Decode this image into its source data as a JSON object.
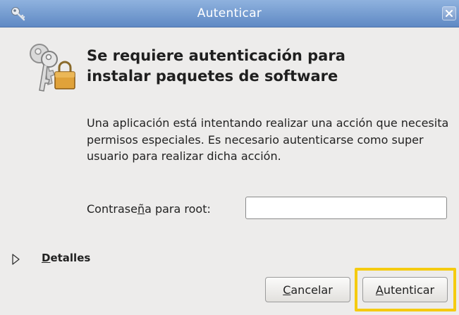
{
  "window": {
    "title": "Autenticar"
  },
  "dialog": {
    "heading": "Se requiere autenticación para instalar paquetes de software",
    "message": "Una aplicación está intentando realizar una acción que necesita permisos especiales. Es necesario autenticarse como super usuario para realizar dicha acción.",
    "password_label_before": "Contrase",
    "password_label_mnemonic": "ñ",
    "password_label_after": "a para root:",
    "password_value": "",
    "details_label_mnemonic": "D",
    "details_label_rest": "etalles",
    "details_expanded": false
  },
  "buttons": {
    "cancel_mnemonic": "C",
    "cancel_rest": "ancelar",
    "auth_mnemonic": "A",
    "auth_rest": "utenticar"
  },
  "colors": {
    "titlebar": "#6f97cf",
    "highlight": "#f5cb10",
    "background": "#edeceb"
  },
  "icons": {
    "title": "key-icon",
    "dialog": "keys-lock-icon",
    "close": "close-icon",
    "expander": "triangle-right-icon"
  }
}
